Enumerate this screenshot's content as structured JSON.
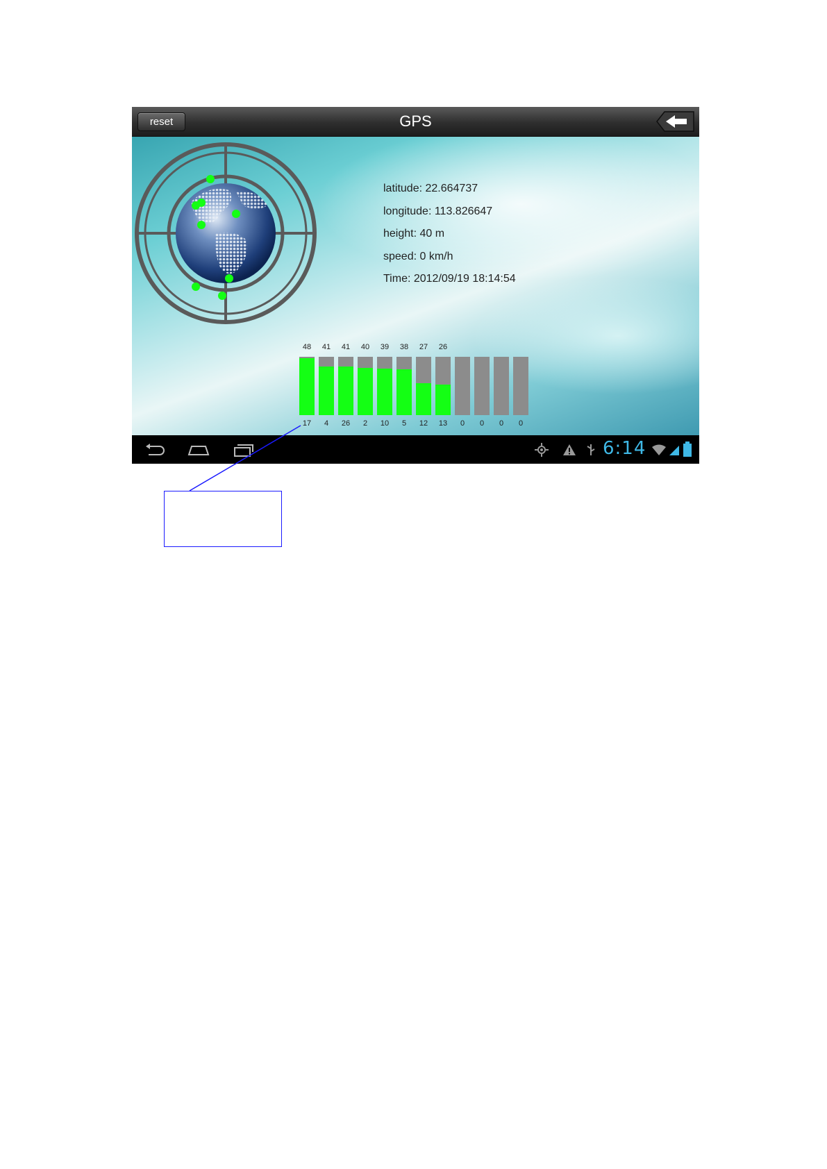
{
  "header": {
    "reset_label": "reset",
    "title": "GPS",
    "back_icon": "back-arrow-icon"
  },
  "info": {
    "latitude": "latitude: 22.664737",
    "longitude": "longitude: 113.826647",
    "height": "height: 40 m",
    "speed": "speed: 0 km/h",
    "time": "Time: 2012/09/19  18:14:54"
  },
  "satellites": {
    "snr": [
      "48",
      "41",
      "41",
      "40",
      "39",
      "38",
      "27",
      "26",
      "",
      "",
      "",
      ""
    ],
    "prn": [
      "17",
      "4",
      "26",
      "2",
      "10",
      "5",
      "12",
      "13",
      "0",
      "0",
      "0",
      "0"
    ],
    "fill_fraction": [
      0.98,
      0.83,
      0.83,
      0.81,
      0.8,
      0.78,
      0.55,
      0.52,
      0,
      0,
      0,
      0
    ]
  },
  "statusbar": {
    "clock": "6:14",
    "icons": [
      "location-icon",
      "warning-icon",
      "usb-icon",
      "wifi-icon",
      "signal-icon",
      "battery-icon"
    ]
  },
  "nav": {
    "icons": [
      "back-nav-icon",
      "home-icon",
      "recent-apps-icon"
    ]
  },
  "colors": {
    "fix": "#14ff14",
    "nofix": "#8c8c8c",
    "clock": "#3fb8e6",
    "callout": "#1a1aff"
  }
}
